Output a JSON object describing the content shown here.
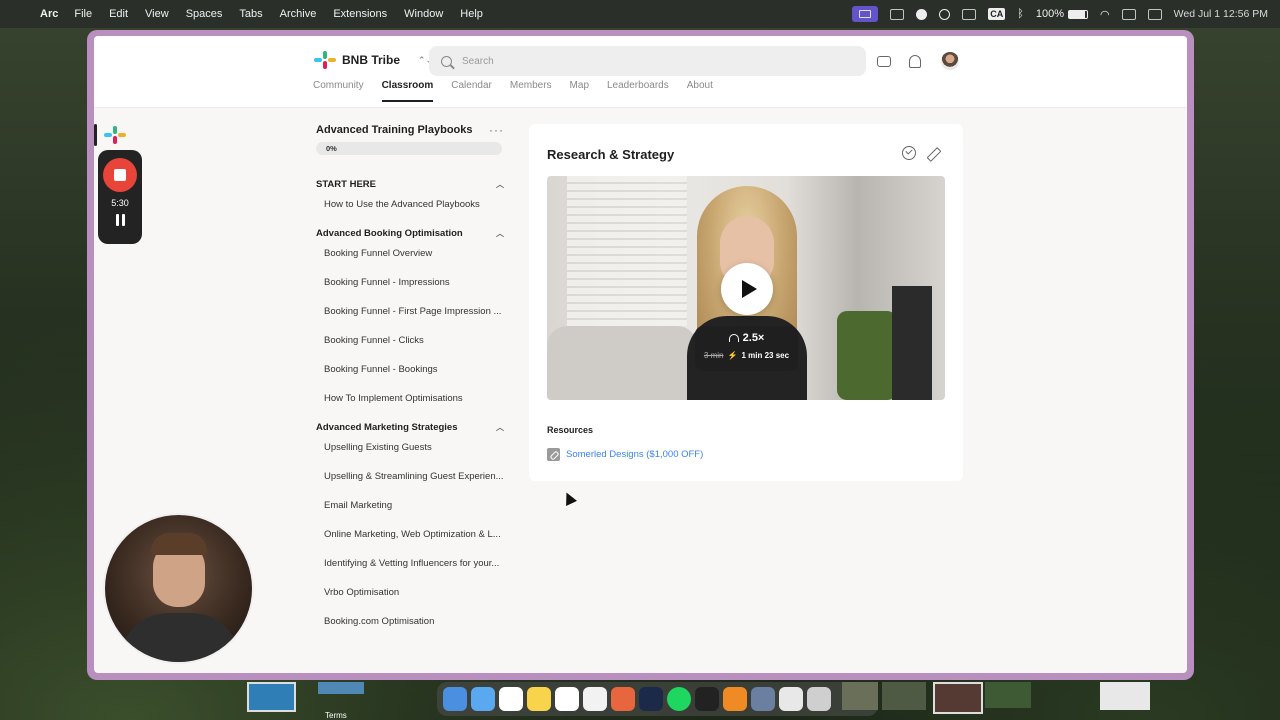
{
  "menubar": {
    "app_name": "Arc",
    "menus": [
      "File",
      "Edit",
      "View",
      "Spaces",
      "Tabs",
      "Archive",
      "Extensions",
      "Window",
      "Help"
    ],
    "battery": "100%",
    "input_source": "CA",
    "clock": "Wed Jul 1  12:56 PM"
  },
  "header": {
    "brand_name": "BNB Tribe",
    "search_placeholder": "Search",
    "tabs": [
      "Community",
      "Classroom",
      "Calendar",
      "Members",
      "Map",
      "Leaderboards",
      "About"
    ],
    "active_tab": "Classroom"
  },
  "recorder": {
    "time": "5:30"
  },
  "course": {
    "title": "Advanced Training Playbooks",
    "progress_label": "0%",
    "progress_value": 0,
    "sections": [
      {
        "title": "START HERE",
        "lessons": [
          "How to Use the Advanced Playbooks"
        ]
      },
      {
        "title": "Advanced Booking Optimisation",
        "lessons": [
          "Booking Funnel Overview",
          "Booking Funnel - Impressions",
          "Booking Funnel - First Page Impression ...",
          "Booking Funnel - Clicks",
          "Booking Funnel - Bookings",
          "How To Implement Optimisations"
        ]
      },
      {
        "title": "Advanced Marketing Strategies",
        "lessons": [
          "Upselling Existing Guests",
          "Upselling & Streamlining Guest Experien...",
          "Email Marketing",
          "Online Marketing, Web Optimization & L...",
          "Identifying & Vetting Influencers for your...",
          "Vrbo Optimisation",
          "Booking.com Optimisation"
        ]
      }
    ]
  },
  "lesson": {
    "title": "Research & Strategy",
    "speed": "2.5×",
    "original_duration": "3 min",
    "fast_duration": "1 min 23 sec",
    "resources_label": "Resources",
    "resource_link": "Somerled Designs ($1,000 OFF)"
  },
  "dock": {
    "terms_label": "Terms"
  },
  "colors": {
    "window_frame": "#b98fc0",
    "link": "#3b82f6",
    "record": "#e8443a"
  }
}
